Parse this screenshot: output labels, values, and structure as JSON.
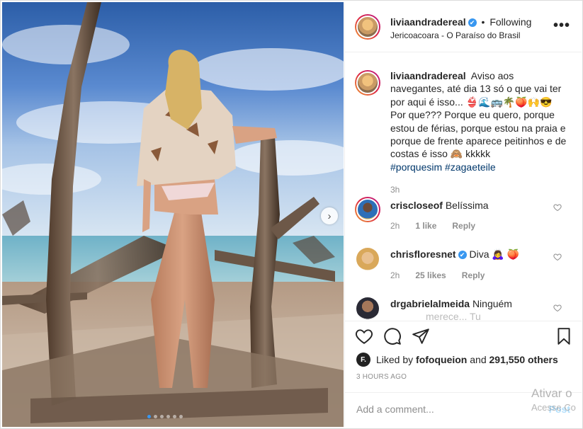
{
  "post": {
    "username": "liviaandradereal",
    "verified_badge": "✔",
    "follow_status": "Following",
    "dot_separator": "•",
    "location": "Jericoacoara - O Paraíso do Brasil",
    "more_label": "•••"
  },
  "caption": {
    "username": "liviaandradereal",
    "text_main": "Aviso aos navegantes, até dia 13 só o que vai ter por aqui é isso... 👙🌊🚌🌴🍑🙌😎 Por que??? Porque eu quero, porque estou de férias, porque estou na praia e porque de frente aparece peitinhos e de costas é isso 🙈 kkkkk",
    "hashtag_1": "#porquesim",
    "hashtag_2": "#zagaeteile",
    "time": "3h"
  },
  "comments": [
    {
      "username": "criscloseof",
      "text": "Belíssima",
      "time": "2h",
      "likes": "1 like",
      "reply": "Reply"
    },
    {
      "username": "chrisfloresnet",
      "verified": "✔",
      "text": "Diva 🙇‍♀️ 🍑",
      "time": "2h",
      "likes": "25 likes",
      "reply": "Reply"
    },
    {
      "username": "drgabrielalmeida",
      "text": "Ninguém",
      "text_cut": "merece... Tu"
    }
  ],
  "actions": {
    "liked_by_prefix": "Liked by",
    "liked_by_user": "fofoqueion",
    "liked_by_and": "and",
    "likes_count": "291,550 others",
    "liker_initial": "F.",
    "timestamp": "3 HOURS AGO",
    "add_comment_placeholder": "Add a comment...",
    "post_label": "Post"
  },
  "carousel": {
    "next_glyph": "›",
    "slides": 6,
    "active_index": 0
  },
  "watermark": {
    "line1": "Ativar o",
    "line2": "Acesse Co"
  },
  "icons": [
    "heart-icon",
    "comment-icon",
    "share-icon",
    "bookmark-icon",
    "more-options-icon",
    "verified-icon",
    "next-arrow-icon"
  ],
  "colors": {
    "link": "#00376b",
    "accent": "#3897f0",
    "secondary_text": "#8e8e8e",
    "post_button": "#b2dffc"
  }
}
